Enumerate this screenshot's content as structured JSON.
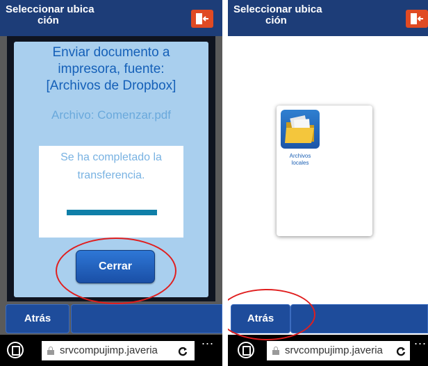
{
  "header": {
    "title_line1": "Seleccionar ubica",
    "title_line2": "ción"
  },
  "left": {
    "dialog": {
      "title_line1": "Enviar documento a",
      "title_line2": "impresora, fuente:",
      "title_line3": "[Archivos de Dropbox]",
      "file_label": "Archivo: Comenzar.pdf",
      "message_line1": "Se ha completado la",
      "message_line2": "transferencia.",
      "progress_fraction": 1.0,
      "close_label": "Cerrar"
    }
  },
  "right": {
    "tile_label_line1": "Archivos",
    "tile_label_line2": "locales"
  },
  "nav": {
    "back_label": "Atrás"
  },
  "browser": {
    "url": "srvcompujimp.javeria",
    "more": "..."
  },
  "colors": {
    "header": "#1d3d78",
    "exit_button": "#e04a23",
    "nav_button": "#1e4c9b",
    "dialog_bg": "#a9cfee",
    "dialog_title": "#1560b8",
    "progress_fill": "#0f7fa8",
    "annotation": "#e01e1e"
  },
  "icons": {
    "exit": "exit-door-icon",
    "tabs": "tabs-icon",
    "lock": "lock-icon",
    "refresh": "refresh-icon",
    "folder": "folder-icon"
  }
}
